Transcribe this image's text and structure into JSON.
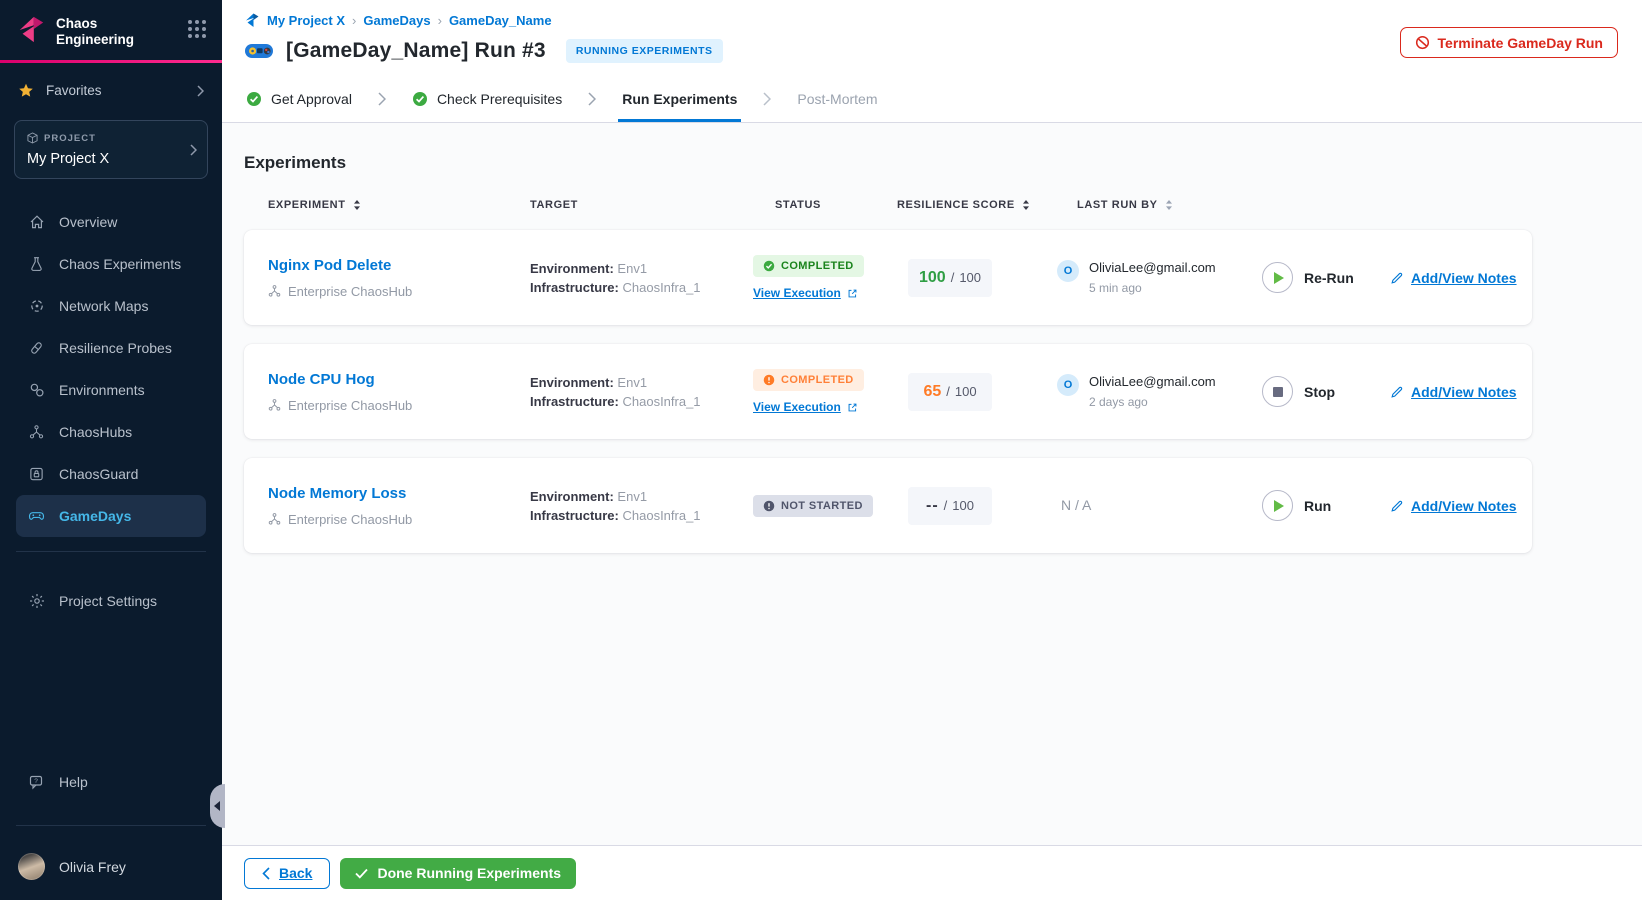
{
  "colors": {
    "brand_magenta": "#e6006e",
    "link_blue": "#0278d5",
    "danger_red": "#da291d",
    "success_green": "#42ab45",
    "warn_orange": "#ff7b26",
    "sidebar_bg": "#0b1b2d",
    "active_nav_blue": "#45b7e8"
  },
  "sidebar": {
    "brand_title": "Chaos\nEngineering",
    "favorites_label": "Favorites",
    "project": {
      "label": "PROJECT",
      "name": "My Project X"
    },
    "nav": [
      {
        "label": "Overview",
        "icon": "home-icon"
      },
      {
        "label": "Chaos Experiments",
        "icon": "flask-icon"
      },
      {
        "label": "Network Maps",
        "icon": "network-maps-icon"
      },
      {
        "label": "Resilience Probes",
        "icon": "probe-icon"
      },
      {
        "label": "Environments",
        "icon": "environments-icon"
      },
      {
        "label": "ChaosHubs",
        "icon": "hub-icon"
      },
      {
        "label": "ChaosGuard",
        "icon": "shield-lock-icon"
      },
      {
        "label": "GameDays",
        "icon": "gamepad-icon",
        "active": true
      }
    ],
    "settings_label": "Project Settings",
    "help_label": "Help",
    "user_name": "Olivia Frey"
  },
  "header": {
    "breadcrumb": {
      "crumb1": "My Project X",
      "crumb2": "GameDays",
      "crumb3": "GameDay_Name",
      "separator": "›"
    },
    "title": "[GameDay_Name] Run #3",
    "status_badge": "RUNNING EXPERIMENTS",
    "terminate_label": "Terminate GameDay Run"
  },
  "stepper": {
    "steps": [
      {
        "label": "Get Approval",
        "state": "done"
      },
      {
        "label": "Check Prerequisites",
        "state": "done"
      },
      {
        "label": "Run Experiments",
        "state": "active"
      },
      {
        "label": "Post-Mortem",
        "state": "upcoming"
      }
    ]
  },
  "experiments": {
    "heading": "Experiments",
    "columns": {
      "experiment": "EXPERIMENT",
      "target": "TARGET",
      "status": "STATUS",
      "score": "RESILIENCE SCORE",
      "last_run_by": "LAST RUN BY"
    },
    "rows": [
      {
        "name": "Nginx Pod Delete",
        "hub": "Enterprise ChaosHub",
        "environment_label": "Environment:",
        "environment": "Env1",
        "infrastructure_label": "Infrastructure:",
        "infrastructure": "ChaosInfra_1",
        "status": "COMPLETED",
        "status_kind": "success",
        "view_execution": "View Execution",
        "score": "100",
        "score_separator": "/",
        "score_max": "100",
        "score_kind": "good",
        "runner_initial": "O",
        "runner_email": "OliviaLee@gmail.com",
        "runner_time": "5 min ago",
        "action": "Re-Run",
        "action_kind": "play",
        "notes": "Add/View Notes"
      },
      {
        "name": "Node CPU Hog",
        "hub": "Enterprise ChaosHub",
        "environment_label": "Environment:",
        "environment": "Env1",
        "infrastructure_label": "Infrastructure:",
        "infrastructure": "ChaosInfra_1",
        "status": "COMPLETED",
        "status_kind": "warn",
        "view_execution": "View Execution",
        "score": "65",
        "score_separator": "/",
        "score_max": "100",
        "score_kind": "warn",
        "runner_initial": "O",
        "runner_email": "OliviaLee@gmail.com",
        "runner_time": "2 days ago",
        "action": "Stop",
        "action_kind": "stop",
        "notes": "Add/View Notes"
      },
      {
        "name": "Node Memory Loss",
        "hub": "Enterprise ChaosHub",
        "environment_label": "Environment:",
        "environment": "Env1",
        "infrastructure_label": "Infrastructure:",
        "infrastructure": "ChaosInfra_1",
        "status": "NOT STARTED",
        "status_kind": "neutral",
        "score": "--",
        "score_separator": "/",
        "score_max": "100",
        "score_kind": "none",
        "runner_na": "N / A",
        "action": "Run",
        "action_kind": "play",
        "notes": "Add/View Notes"
      }
    ]
  },
  "footer": {
    "back_label": "Back",
    "done_label": "Done Running Experiments"
  }
}
